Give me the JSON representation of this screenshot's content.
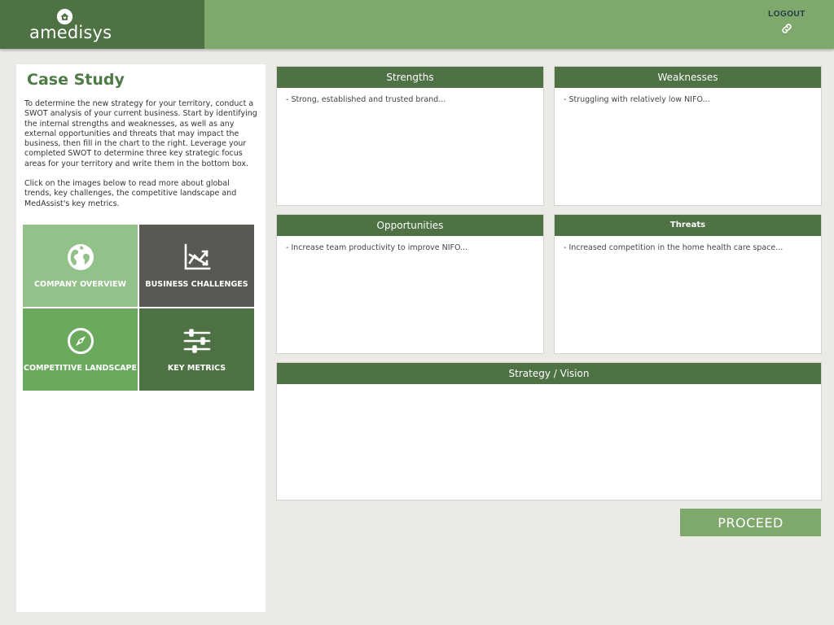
{
  "header": {
    "logo_text": "amedisys",
    "logout_label": "LOGOUT",
    "logout_icon": "link-icon"
  },
  "case_study": {
    "title": "Case Study",
    "paragraph_1": "To determine the new strategy for your territory, conduct a SWOT analysis of your current business. Start by identifying the internal strengths and weaknesses, as well as any external opportunities and threats that may impact the business, then fill in the chart to the right. Leverage your completed SWOT to determine three key strategic focus areas for your territory and write them in the bottom box.",
    "paragraph_2": "Click on the images below to read more about global trends, key challenges, the competitive landscape and MedAssist's key metrics."
  },
  "tiles": [
    {
      "label": "COMPANY OVERVIEW",
      "icon": "globe-icon",
      "color": "#93c18a"
    },
    {
      "label": "BUSINESS CHALLENGES",
      "icon": "chart-trend-icon",
      "color": "#5a5852"
    },
    {
      "label": "COMPETITIVE LANDSCAPE",
      "icon": "compass-icon",
      "color": "#6aa95e"
    },
    {
      "label": "KEY METRICS",
      "icon": "sliders-icon",
      "color": "#4e7244"
    }
  ],
  "swot": {
    "strengths": {
      "title": "Strengths",
      "text": "- Strong, established and trusted brand..."
    },
    "weaknesses": {
      "title": "Weaknesses",
      "text": "- Struggling with relatively low NIFO..."
    },
    "opportunities": {
      "title": "Opportunities",
      "text": "- Increase team productivity to improve NIFO..."
    },
    "threats": {
      "title": "Threats",
      "text": "- Increased competition in the home health care space..."
    },
    "strategy": {
      "title": "Strategy / Vision",
      "text": ""
    }
  },
  "proceed_label": "PROCEED",
  "colors": {
    "brand_dark": "#4e7244",
    "brand_light": "#7fa86d",
    "background": "#ebeae6"
  }
}
